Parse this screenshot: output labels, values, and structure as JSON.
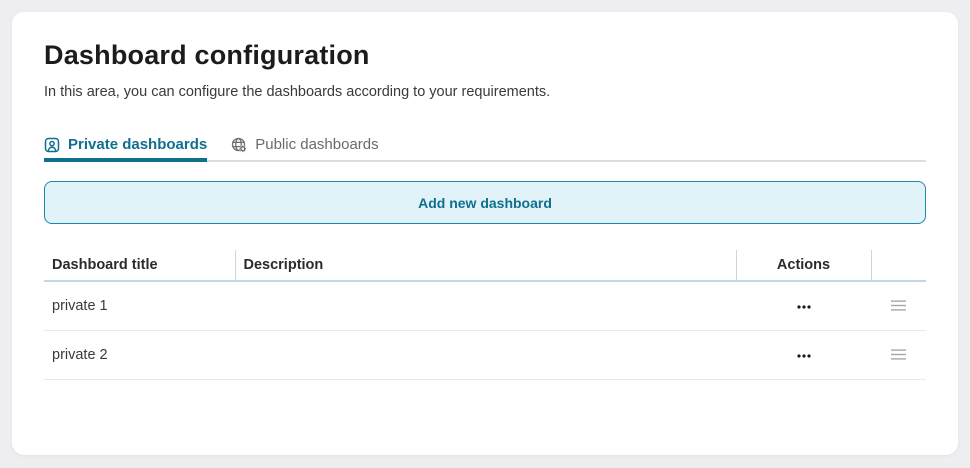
{
  "page": {
    "title": "Dashboard configuration",
    "subtitle": "In this area, you can configure the dashboards according to your requirements."
  },
  "tabs": [
    {
      "label": "Private dashboards",
      "icon": "user-badge-icon",
      "active": true
    },
    {
      "label": "Public dashboards",
      "icon": "globe-gear-icon",
      "active": false
    }
  ],
  "add_button": {
    "label": "Add new dashboard"
  },
  "table": {
    "columns": [
      "Dashboard title",
      "Description",
      "Actions",
      ""
    ],
    "rows": [
      {
        "title": "private 1",
        "description": "",
        "actions_icon": "ellipsis-icon",
        "drag_icon": "drag-handle-icon"
      },
      {
        "title": "private 2",
        "description": "",
        "actions_icon": "ellipsis-icon",
        "drag_icon": "drag-handle-icon"
      }
    ]
  },
  "colors": {
    "accent": "#0f708e",
    "btn_bg": "#e1f2f9",
    "btn_border": "#1d87a7",
    "tab_inactive": "#6a6a6e",
    "header_underline": "#b9dce8",
    "page_bg": "#eeeef0"
  }
}
